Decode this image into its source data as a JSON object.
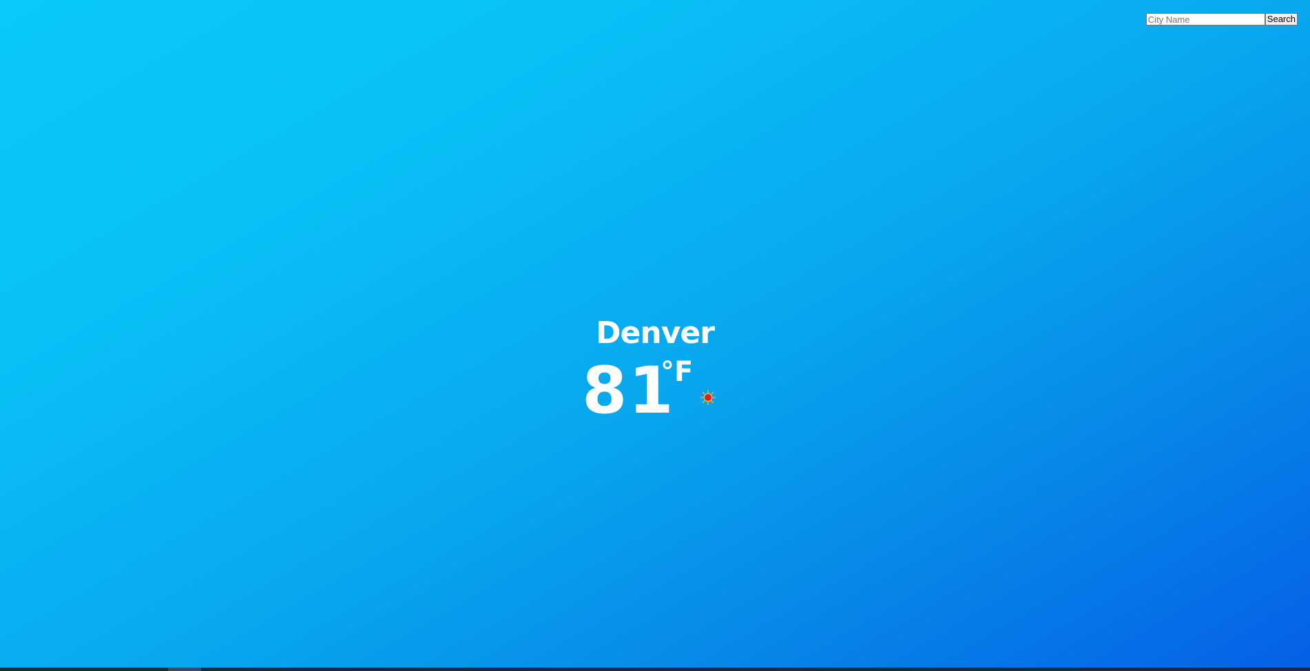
{
  "search": {
    "placeholder": "City Name",
    "value": "",
    "button_label": "Search"
  },
  "weather": {
    "city": "Denver",
    "temperature": "81",
    "unit": "°F",
    "condition_icon": "sun-icon"
  },
  "colors": {
    "background_start": "#0ac8fa",
    "background_end": "#0560e6",
    "text": "#ffffff",
    "sun_core": "#e0201a",
    "sun_rays": "#f5a623"
  }
}
